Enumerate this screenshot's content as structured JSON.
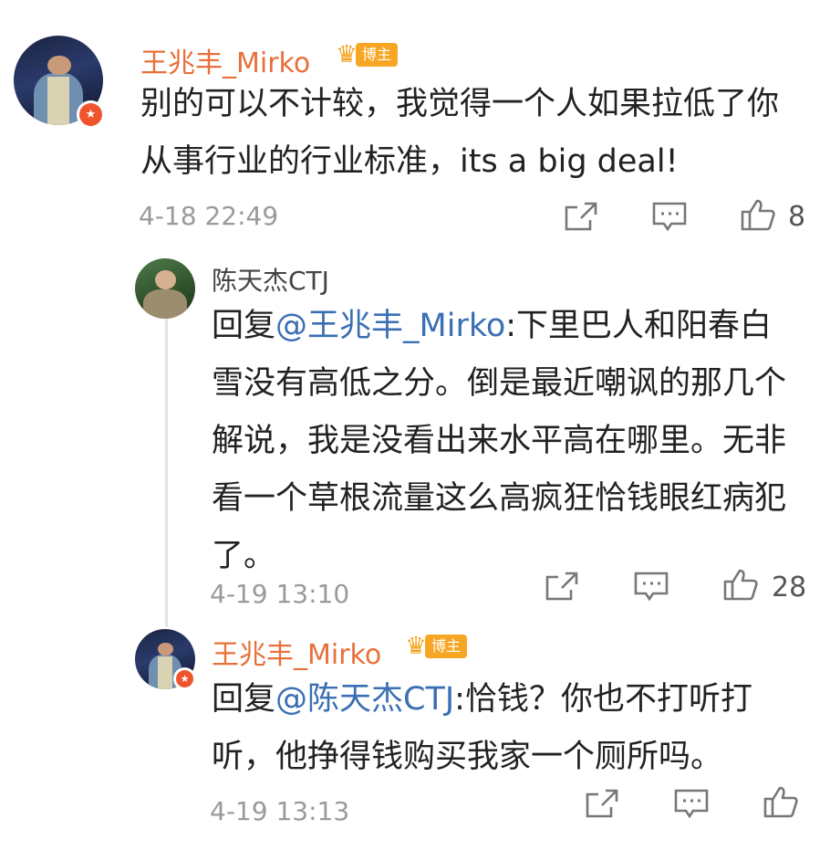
{
  "comments": [
    {
      "username": "王兆丰_Mirko",
      "badge": "博主",
      "text": "别的可以不计较，我觉得一个人如果拉低了你从事行业的行业标准，its a big deal!",
      "time": "4-18 22:49",
      "like_count": "8"
    },
    {
      "username": "陈天杰CTJ",
      "reply_prefix": "回复",
      "mention": "@王兆丰_Mirko",
      "text": ":下里巴人和阳春白雪没有高低之分。倒是最近嘲讽的那几个解说，我是没看出来水平高在哪里。无非看一个草根流量这么高疯狂恰钱眼红病犯了。",
      "time": "4-19 13:10",
      "like_count": "28"
    },
    {
      "username": "王兆丰_Mirko",
      "badge": "博主",
      "reply_prefix": "回复",
      "mention": "@陈天杰CTJ",
      "text": ":恰钱？你也不打听打听，他挣得钱购买我家一个厕所吗。",
      "time": "4-19 13:13",
      "like_count": ""
    }
  ],
  "icons": {
    "share": "share-icon",
    "comment": "comment-icon",
    "like": "like-icon",
    "crown": "crown-icon",
    "verified": "verified-badge-icon"
  },
  "colors": {
    "username": "#e8703a",
    "mention": "#3a6fb3",
    "badge": "#f6a623",
    "verified": "#f0542d"
  }
}
